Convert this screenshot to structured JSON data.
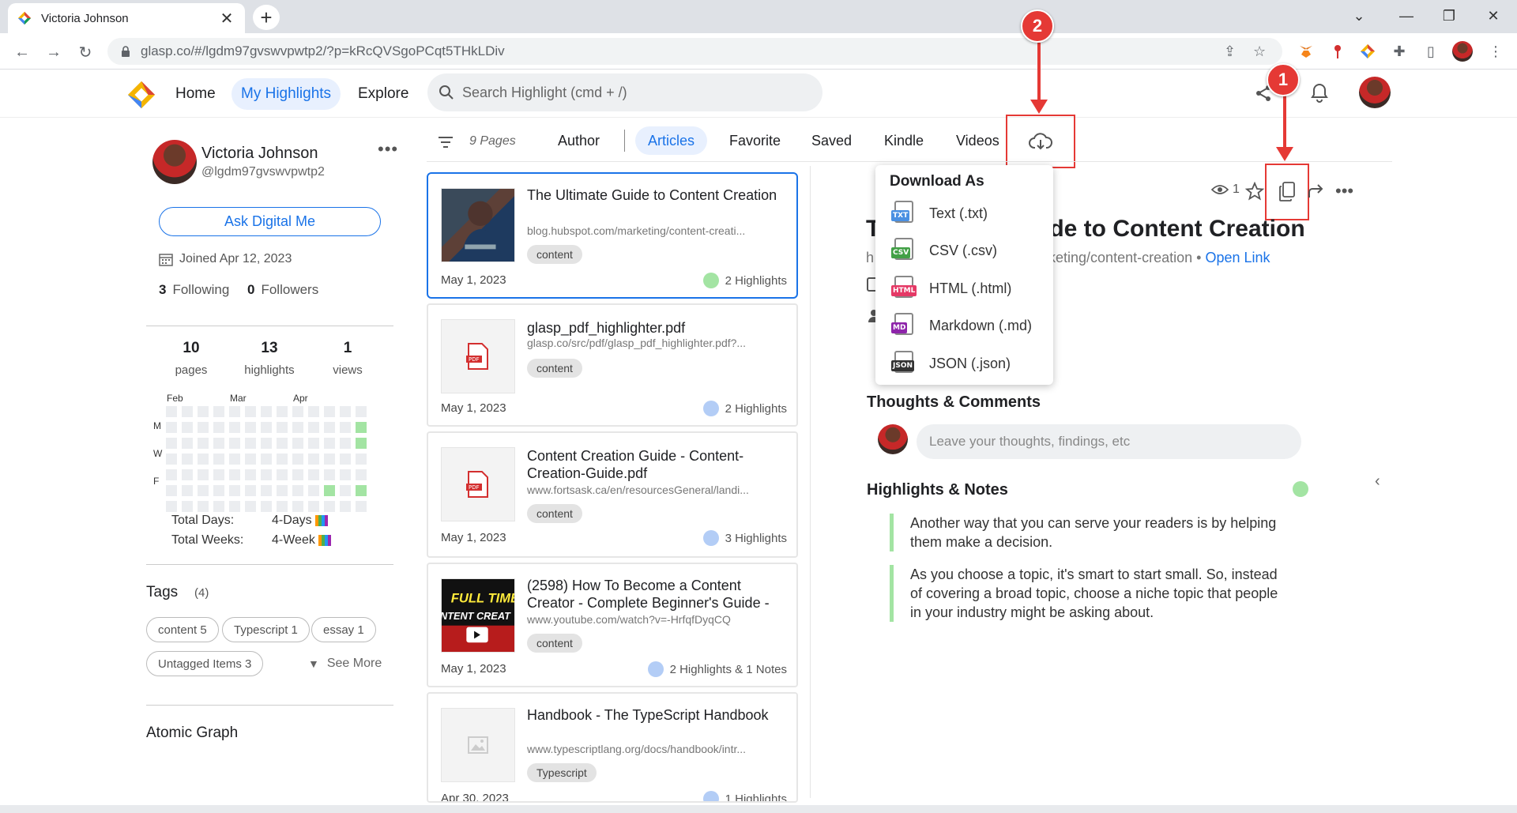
{
  "browser": {
    "tab_title": "Victoria Johnson",
    "url": "glasp.co/#/lgdm97gvswvpwtp2/?p=kRcQVSgoPCqt5THkLDiv"
  },
  "nav": {
    "home": "Home",
    "my_highlights": "My Highlights",
    "explore": "Explore",
    "search_placeholder": "Search Highlight (cmd + /)"
  },
  "profile": {
    "name": "Victoria Johnson",
    "handle": "@lgdm97gvswvpwtp2",
    "ask_button": "Ask Digital Me",
    "joined": "Joined Apr 12, 2023",
    "following_count": "3",
    "following_label": "Following",
    "followers_count": "0",
    "followers_label": "Followers",
    "stats": [
      {
        "num": "10",
        "label": "pages"
      },
      {
        "num": "13",
        "label": "highlights"
      },
      {
        "num": "1",
        "label": "views"
      }
    ],
    "heatmap": {
      "months": [
        "Feb",
        "Mar",
        "Apr"
      ],
      "days": [
        "M",
        "W",
        "F"
      ],
      "total_days_label": "Total Days:",
      "total_days_value": "4-Days",
      "total_weeks_label": "Total Weeks:",
      "total_weeks_value": "4-Week"
    },
    "tags_title": "Tags",
    "tags_count": "(4)",
    "tags": [
      "content 5",
      "Typescript 1",
      "essay 1",
      "Untagged Items 3"
    ],
    "see_more": "See More",
    "atomic_graph": "Atomic Graph"
  },
  "filters": {
    "pages_count": "9 Pages",
    "tabs": [
      "Author",
      "Articles",
      "Favorite",
      "Saved",
      "Kindle",
      "Videos"
    ],
    "active_tab": "Articles"
  },
  "cards": [
    {
      "title": "The Ultimate Guide to Content Creation",
      "url": "blog.hubspot.com/marketing/content-creati...",
      "tag": "content",
      "date": "May 1, 2023",
      "highlights": "2 Highlights",
      "dot_color": "#a3e4a3"
    },
    {
      "title": "glasp_pdf_highlighter.pdf",
      "url": "glasp.co/src/pdf/glasp_pdf_highlighter.pdf?...",
      "tag": "content",
      "date": "May 1, 2023",
      "highlights": "2 Highlights",
      "dot_color": "#b3cdf6"
    },
    {
      "title": "Content Creation Guide - Content-Creation-Guide.pdf",
      "url": "www.fortsask.ca/en/resourcesGeneral/landi...",
      "tag": "content",
      "date": "May 1, 2023",
      "highlights": "3 Highlights",
      "dot_color": "#b3cdf6"
    },
    {
      "title": "(2598) How To Become a Content Creator - Complete Beginner's Guide -",
      "url": "www.youtube.com/watch?v=-HrfqfDyqCQ",
      "tag": "content",
      "date": "May 1, 2023",
      "highlights": "2 Highlights & 1 Notes",
      "dot_color": "#b3cdf6",
      "thumb_text": "FULL TIME",
      "thumb_text2": "NTENT CREAT"
    },
    {
      "title": "Handbook - The TypeScript Handbook",
      "url": "www.typescriptlang.org/docs/handbook/intr...",
      "tag": "Typescript",
      "date": "Apr 30, 2023",
      "highlights": "1 Highlights",
      "dot_color": "#b3cdf6"
    }
  ],
  "detail": {
    "views": "1",
    "title_left": "T",
    "title_right": "de to Content Creation",
    "url_left": "h",
    "url_right": "keting/content-creation",
    "url_sep": "•",
    "open_link": "Open Link",
    "thoughts_title": "Thoughts & Comments",
    "comment_placeholder": "Leave your thoughts, findings, etc",
    "highlights_title": "Highlights & Notes",
    "highlights": [
      "Another way that you can serve your readers is by helping them make a decision.",
      "As you choose a topic, it's smart to start small. So, instead of covering a broad topic, choose a niche topic that people in your industry might be asking about."
    ]
  },
  "download": {
    "title": "Download As",
    "items": [
      {
        "label": "Text (.txt)",
        "badge": "TXT",
        "color": "#4a90e2"
      },
      {
        "label": "CSV (.csv)",
        "badge": "CSV",
        "color": "#43a047"
      },
      {
        "label": "HTML (.html)",
        "badge": "HTML",
        "color": "#e53966"
      },
      {
        "label": "Markdown (.md)",
        "badge": "MD",
        "color": "#8e24aa"
      },
      {
        "label": "JSON (.json)",
        "badge": "JSON",
        "color": "#333333"
      }
    ]
  },
  "annotations": {
    "step1": "1",
    "step2": "2",
    "color": "#e53935"
  }
}
